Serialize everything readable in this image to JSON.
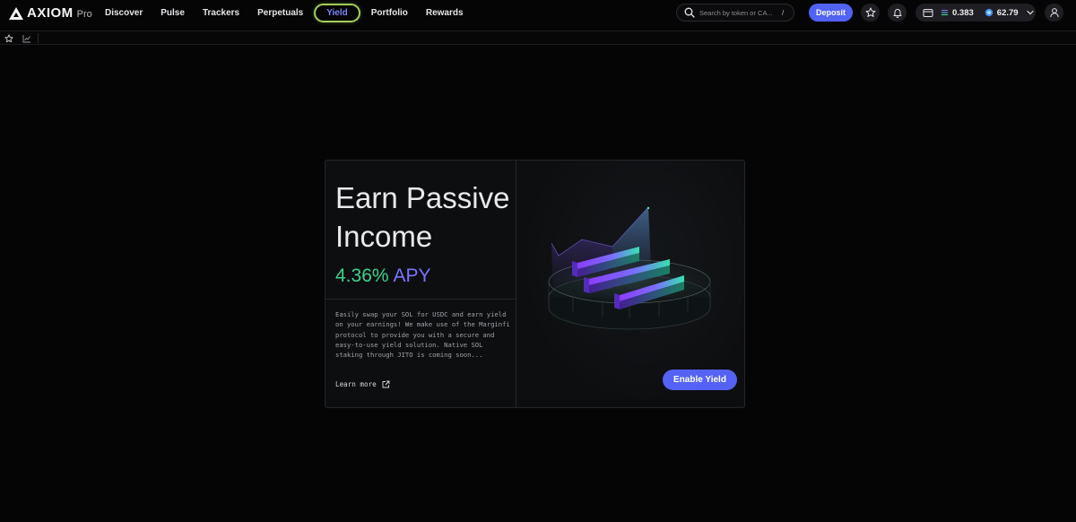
{
  "header": {
    "logo_word": "AXIOM",
    "logo_sub": "Pro",
    "nav": [
      {
        "label": "Discover"
      },
      {
        "label": "Pulse"
      },
      {
        "label": "Trackers"
      },
      {
        "label": "Perpetuals"
      },
      {
        "label": "Yield",
        "active": true
      },
      {
        "label": "Portfolio"
      },
      {
        "label": "Rewards"
      }
    ],
    "search": {
      "placeholder": "Search by token or CA...",
      "shortcut": "/"
    },
    "deposit_label": "Deposit",
    "wallet": {
      "sol_balance": "0.383",
      "points_balance": "62.79"
    }
  },
  "card": {
    "title": "Earn Passive Income",
    "apy_value": "4.36%",
    "apy_label": "APY",
    "description": "Easily swap your SOL for USDC and earn yield on your earnings! We make use of the Marginfi protocol to provide you with a secure and easy-to-use yield solution. Native SOL staking through JITO is coming soon...",
    "learn_more": "Learn more",
    "enable_label": "Enable Yield"
  },
  "colors": {
    "accent": "#5462f5",
    "apy_green": "#3cd48d",
    "apy_purple": "#7c73ff",
    "active_outline": "#a6cf5a",
    "background": "#050506"
  },
  "icons": [
    "search-icon",
    "star-icon",
    "bell-icon",
    "wallet-icon",
    "sol-icon",
    "points-icon",
    "chevron-down-icon",
    "user-icon",
    "chart-icon",
    "external-link-icon"
  ]
}
